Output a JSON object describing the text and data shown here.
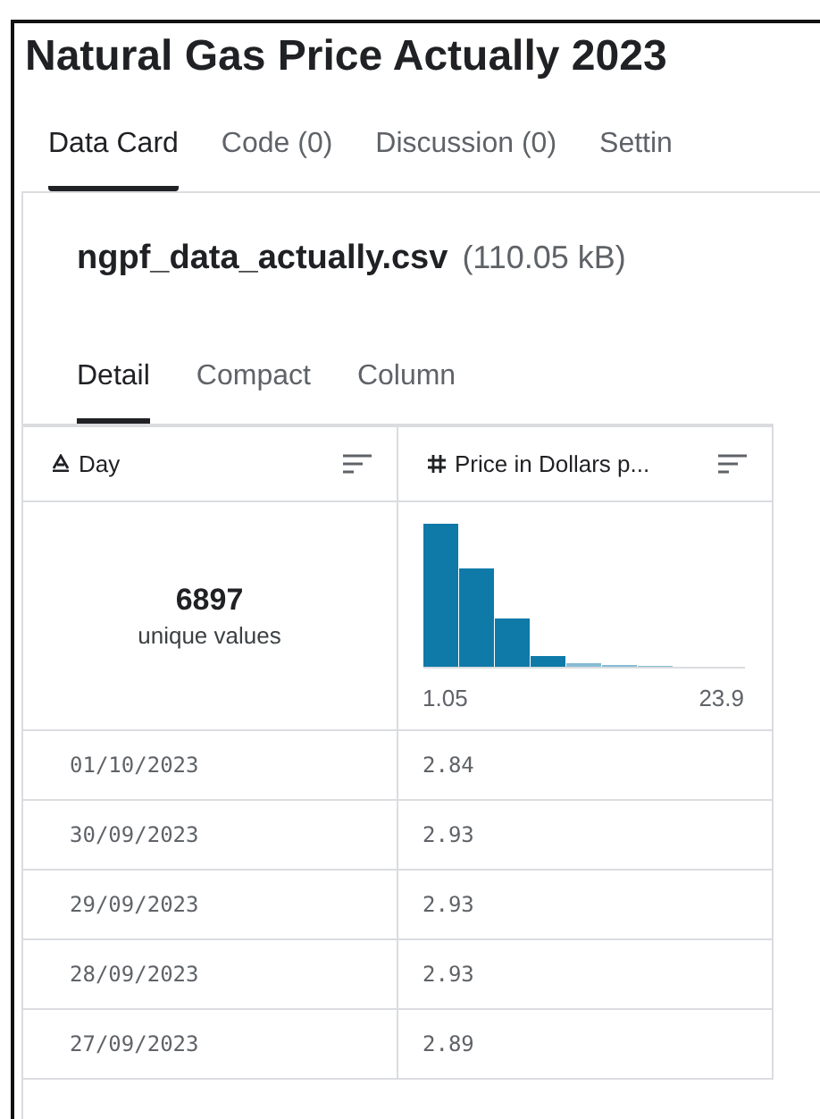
{
  "title": "Natural Gas Price Actually 2023",
  "tabs": [
    {
      "label": "Data Card",
      "selected": true
    },
    {
      "label": "Code (0)",
      "selected": false
    },
    {
      "label": "Discussion (0)",
      "selected": false
    },
    {
      "label": "Settin",
      "selected": false
    }
  ],
  "file": {
    "name": "ngpf_data_actually.csv",
    "size": "(110.05 kB)"
  },
  "view_tabs": [
    {
      "label": "Detail",
      "selected": true
    },
    {
      "label": "Compact",
      "selected": false
    },
    {
      "label": "Column",
      "selected": false
    }
  ],
  "table": {
    "columns": [
      {
        "kind": "text",
        "label": "Day",
        "summary": {
          "kind": "unique",
          "count": "6897",
          "caption": "unique values"
        }
      },
      {
        "kind": "number",
        "label": "Price in Dollars p...",
        "summary": {
          "kind": "histogram",
          "min": "1.05",
          "max": "23.9"
        }
      }
    ],
    "rows": [
      [
        "01/10/2023",
        "2.84"
      ],
      [
        "30/09/2023",
        "2.93"
      ],
      [
        "29/09/2023",
        "2.93"
      ],
      [
        "28/09/2023",
        "2.93"
      ],
      [
        "27/09/2023",
        "2.89"
      ]
    ]
  }
}
